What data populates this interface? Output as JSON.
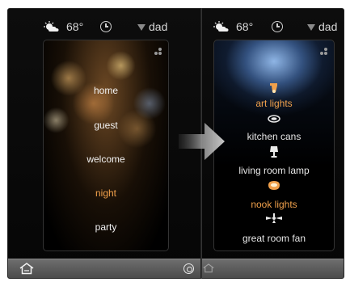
{
  "left": {
    "status": {
      "temperature": "68°",
      "user": "dad"
    },
    "scenes": [
      {
        "label": "home",
        "active": false
      },
      {
        "label": "guest",
        "active": false
      },
      {
        "label": "welcome",
        "active": false
      },
      {
        "label": "night",
        "active": true
      },
      {
        "label": "party",
        "active": false
      }
    ]
  },
  "right": {
    "status": {
      "temperature": "68°",
      "user": "dad"
    },
    "lights": [
      {
        "label": "art lights",
        "icon": "spotlight-icon",
        "on": true
      },
      {
        "label": "kitchen cans",
        "icon": "can-light-icon",
        "on": false
      },
      {
        "label": "living room lamp",
        "icon": "lamp-icon",
        "on": false
      },
      {
        "label": "nook lights",
        "icon": "pendant-light-icon",
        "on": true
      },
      {
        "label": "great room fan",
        "icon": "ceiling-fan-icon",
        "on": false
      }
    ]
  },
  "colors": {
    "accent": "#f0a04b",
    "text": "#f2f2f2",
    "panel": "#0a0a0a",
    "bar": "#5d5d5d"
  },
  "icons": [
    "weather-partly-cloudy-icon",
    "clock-icon",
    "dropdown-triangle-icon",
    "menu-dots-icon",
    "home-icon",
    "target-icon",
    "arrow-right-icon"
  ]
}
